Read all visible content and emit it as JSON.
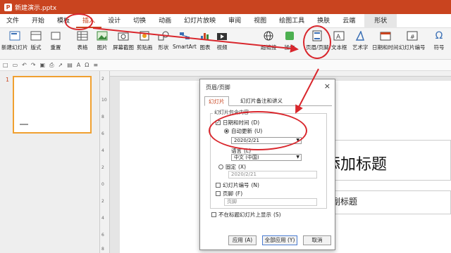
{
  "window": {
    "title": "新建演示.pptx"
  },
  "menu": [
    "文件",
    "开始",
    "模板",
    "插入",
    "设计",
    "切换",
    "动画",
    "幻灯片放映",
    "审阅",
    "视图",
    "绘图工具",
    "换肤",
    "云端",
    "形状"
  ],
  "ribbon": {
    "buttons": [
      "新建幻灯片",
      "版式",
      "重置",
      "表格",
      "图片",
      "屏幕截图",
      "剪贴画",
      "形状",
      "SmartArt",
      "图表",
      "视频",
      "超链接",
      "操作",
      "页眉/页脚",
      "文本框",
      "艺术字",
      "日期和时间",
      "幻灯片编号",
      "符号"
    ]
  },
  "thumbs": {
    "number": "1"
  },
  "vruler": [
    "2",
    "10",
    "8",
    "6",
    "4",
    "2",
    "0",
    "2",
    "4",
    "6",
    "8"
  ],
  "slide": {
    "title_text": "添加标题",
    "subtitle_text": "加副标题"
  },
  "dialog": {
    "title": "页眉/页脚",
    "close": "×",
    "tabs": [
      "幻灯片",
      "幻灯片备注和讲义"
    ],
    "group_label": "幻灯片包含内容",
    "datetime_label": "日期和时间",
    "datetime_key": "(D)",
    "auto_update_label": "自动更新",
    "auto_update_key": "(U)",
    "date_value": "2020/2/21",
    "language_label": "语言",
    "language_key": "(L)",
    "language_value": "中文 (中国)",
    "fixed_label": "固定",
    "fixed_key": "(X)",
    "fixed_value": "2020/2/21",
    "slide_number_label": "幻灯片编号",
    "slide_number_key": "(N)",
    "footer_label": "页脚",
    "footer_key": "(F)",
    "footer_placeholder": "页脚",
    "no_title_label": "不在标题幻灯片上显示",
    "no_title_key": "(S)",
    "apply_label": "应用",
    "apply_key": "(A)",
    "apply_all_label": "全部应用",
    "apply_all_key": "(Y)",
    "cancel_label": "取消"
  },
  "colors": {
    "accent": "#c9441f",
    "annotation": "#d9262c"
  }
}
